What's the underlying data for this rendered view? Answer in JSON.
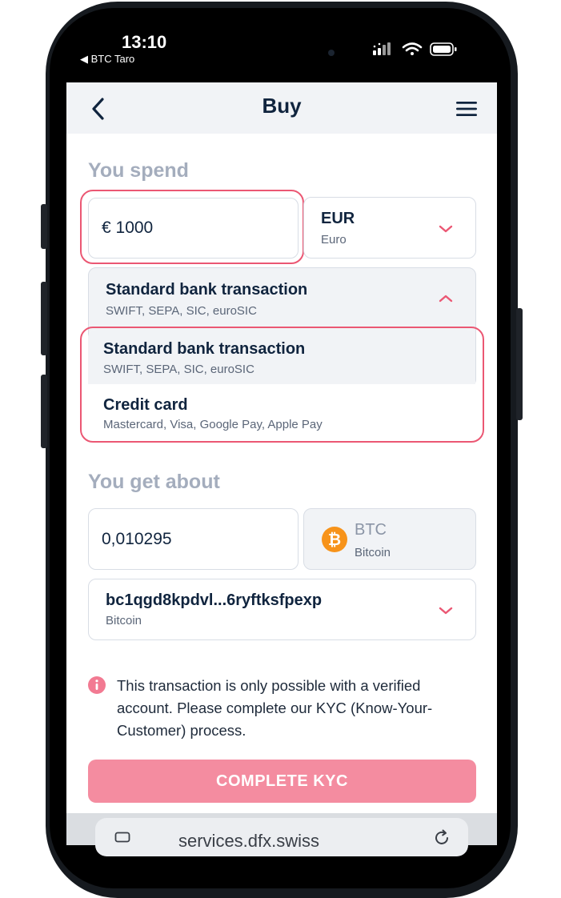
{
  "status_bar": {
    "time": "13:10",
    "back_app": "◀ BTC Taro"
  },
  "header": {
    "title": "Buy"
  },
  "spend": {
    "label": "You spend",
    "amount": "€ 1000",
    "currency_code": "EUR",
    "currency_name": "Euro",
    "payment_selected": {
      "title": "Standard bank transaction",
      "subtitle": "SWIFT, SEPA, SIC, euroSIC"
    },
    "payment_options": [
      {
        "title": "Standard bank transaction",
        "subtitle": "SWIFT, SEPA, SIC, euroSIC"
      },
      {
        "title": "Credit card",
        "subtitle": "Mastercard, Visa, Google Pay, Apple Pay"
      }
    ]
  },
  "receive": {
    "label": "You get about",
    "amount": "0,010295",
    "asset_code": "BTC",
    "asset_name": "Bitcoin",
    "address": "bc1qgd8kpdvl...6ryftksfpexp",
    "address_network": "Bitcoin"
  },
  "notice": {
    "text": "This transaction is only possible with a verified account. Please complete our KYC (Know-Your-Customer) process."
  },
  "actions": {
    "complete_kyc": "COMPLETE KYC"
  },
  "browser": {
    "url": "services.dfx.swiss"
  },
  "colors": {
    "accent": "#eb5773",
    "button": "#f48ca0",
    "text_primary": "#10243e",
    "label_muted": "#a4adbd",
    "bitcoin_orange": "#f7931a"
  }
}
